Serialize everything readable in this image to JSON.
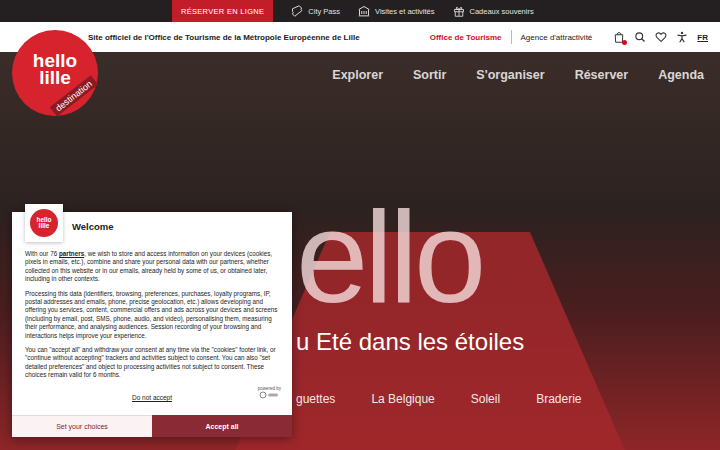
{
  "topbar": {
    "items": [
      {
        "label": "RÉSERVER EN LIGNE",
        "kind": "cta"
      },
      {
        "label": "City Pass",
        "kind": "ticket"
      },
      {
        "label": "Visites et activités",
        "kind": "building"
      },
      {
        "label": "Cadeaux souvenirs",
        "kind": "gift"
      }
    ]
  },
  "header": {
    "tagline": "Site officiel de l'Office de Tourisme de la Métropole Européenne de Lille",
    "links": [
      {
        "label": "Office de Tourisme",
        "selected": true
      },
      {
        "label": "Agence d'attractivité",
        "selected": false
      }
    ],
    "language": "FR"
  },
  "logo": {
    "line1": "hello",
    "line2": "lille",
    "line3": "destination"
  },
  "nav": [
    "Explorer",
    "Sortir",
    "S'organiser",
    "Réserver",
    "Agenda"
  ],
  "hero": {
    "title": "ello",
    "subtitle": "u Eté dans les étoiles",
    "tags": [
      "guettes",
      "La Belgique",
      "Soleil",
      "Braderie"
    ]
  },
  "consent": {
    "logo": {
      "line1": "hello",
      "line2": "lille"
    },
    "title": "Welcome",
    "intro_before": "With our 76 ",
    "intro_link": "partners",
    "intro_after": ", we wish to store and access information on your devices (cookies, pixels in emails, etc.), combine and share your personal data with our partners, whether collected on this website or in our emails, already held by some of us, or obtained later, including in other contexts.",
    "paragraphs": [
      "Processing this data (identifiers, browsing, preferences, purchases, loyalty programs, IP, postal addresses and emails, phone, precise geolocation, etc.) allows developing and offering you services, content, commercial offers and ads across your devices and screens (including by email, post, SMS, phone, audio, and video), personalising them, measuring their performance, and analysing audiences. Session recording of your browsing and interactions helps improve your experience.",
      "You can \"accept all\" and withdraw your consent at any time via the \"cookies\" footer link, or \"continue without accepting\" trackers and activities subject to consent. You can also \"set detailed preferences\" and object to processing activities not subject to consent. These choices remain valid for 6 months."
    ],
    "reject": "Do not accept",
    "powered_by": "powered by",
    "buttons": [
      {
        "label": "Set your choices",
        "kind": "secondary"
      },
      {
        "label": "Accept all",
        "kind": "primary"
      }
    ]
  }
}
